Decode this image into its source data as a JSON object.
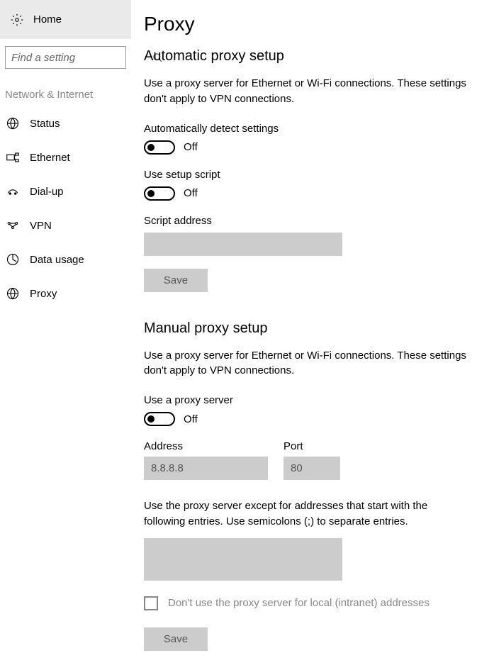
{
  "sidebar": {
    "home_label": "Home",
    "search_placeholder": "Find a setting",
    "section_label": "Network & Internet",
    "items": [
      {
        "label": "Status"
      },
      {
        "label": "Ethernet"
      },
      {
        "label": "Dial-up"
      },
      {
        "label": "VPN"
      },
      {
        "label": "Data usage"
      },
      {
        "label": "Proxy"
      }
    ]
  },
  "main": {
    "title": "Proxy",
    "auto": {
      "heading": "Automatic proxy setup",
      "desc": "Use a proxy server for Ethernet or Wi-Fi connections. These settings don't apply to VPN connections.",
      "detect_label": "Automatically detect settings",
      "detect_state": "Off",
      "script_label": "Use setup script",
      "script_state": "Off",
      "script_addr_label": "Script address",
      "save_label": "Save"
    },
    "manual": {
      "heading": "Manual proxy setup",
      "desc": "Use a proxy server for Ethernet or Wi-Fi connections. These settings don't apply to VPN connections.",
      "use_label": "Use a proxy server",
      "use_state": "Off",
      "address_label": "Address",
      "address_placeholder": "8.8.8.8",
      "port_label": "Port",
      "port_placeholder": "80",
      "except_desc": "Use the proxy server except for addresses that start with the following entries. Use semicolons (;) to separate entries.",
      "local_label": "Don't use the proxy server for local (intranet) addresses",
      "save_label": "Save"
    }
  }
}
